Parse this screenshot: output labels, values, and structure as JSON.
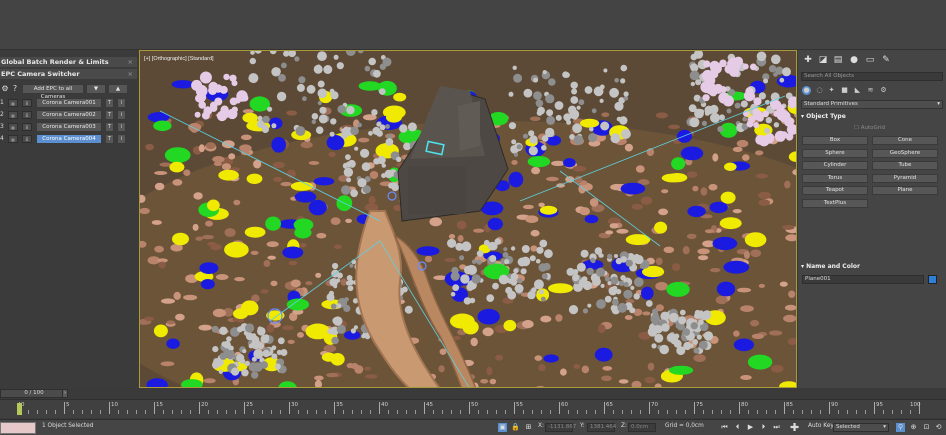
{
  "left_panel": {
    "rollout1_title": "Global Batch Render & Limits",
    "rollout2_title": "EPC Camera Switcher",
    "add_epc_label": "Add EPC to all Cameras",
    "cameras": [
      {
        "num": "1",
        "name": "Corona Camera001",
        "active": false
      },
      {
        "num": "2",
        "name": "Corona Camera002",
        "active": false
      },
      {
        "num": "3",
        "name": "Corona Camera003",
        "active": false
      },
      {
        "num": "4",
        "name": "Corona Camera004",
        "active": true
      }
    ]
  },
  "viewport": {
    "label": "[+] [Orthographic] [Standard]"
  },
  "command_panel": {
    "search_placeholder": "Search All Objects",
    "category": "Standard Primitives",
    "object_type_title": "Object Type",
    "autogrid_label": "AutoGrid",
    "object_buttons": [
      "Box",
      "Cone",
      "Sphere",
      "GeoSphere",
      "Cylinder",
      "Tube",
      "Torus",
      "Pyramid",
      "Teapot",
      "Plane",
      "TextPlus"
    ],
    "name_color_title": "Name and Color",
    "object_name": "Plane001",
    "object_color": "#2f7fd8"
  },
  "timeline": {
    "frame_display": "0 / 100",
    "tick_labels": [
      "0",
      "5",
      "10",
      "15",
      "20",
      "25",
      "30",
      "35",
      "40",
      "45",
      "50",
      "55",
      "60",
      "65",
      "70",
      "75",
      "80",
      "85",
      "90",
      "95",
      "100"
    ]
  },
  "status_bar": {
    "selection_text": "1 Object Selected",
    "x_label": "X:",
    "x_value": "-1131.867",
    "y_label": "Y:",
    "y_value": "1381.464",
    "z_label": "Z:",
    "z_value": "0.0cm",
    "grid_text": "Grid = 0,0cm",
    "autokey_label": "Auto Key",
    "selected_dropdown": "Selected"
  },
  "colors": {
    "viewport_border": "#a99a3a",
    "active_camera": "#5b8fcf",
    "flower_blue": "#1a1ae0",
    "flower_yellow": "#f0ea00",
    "flower_green": "#22d822"
  }
}
